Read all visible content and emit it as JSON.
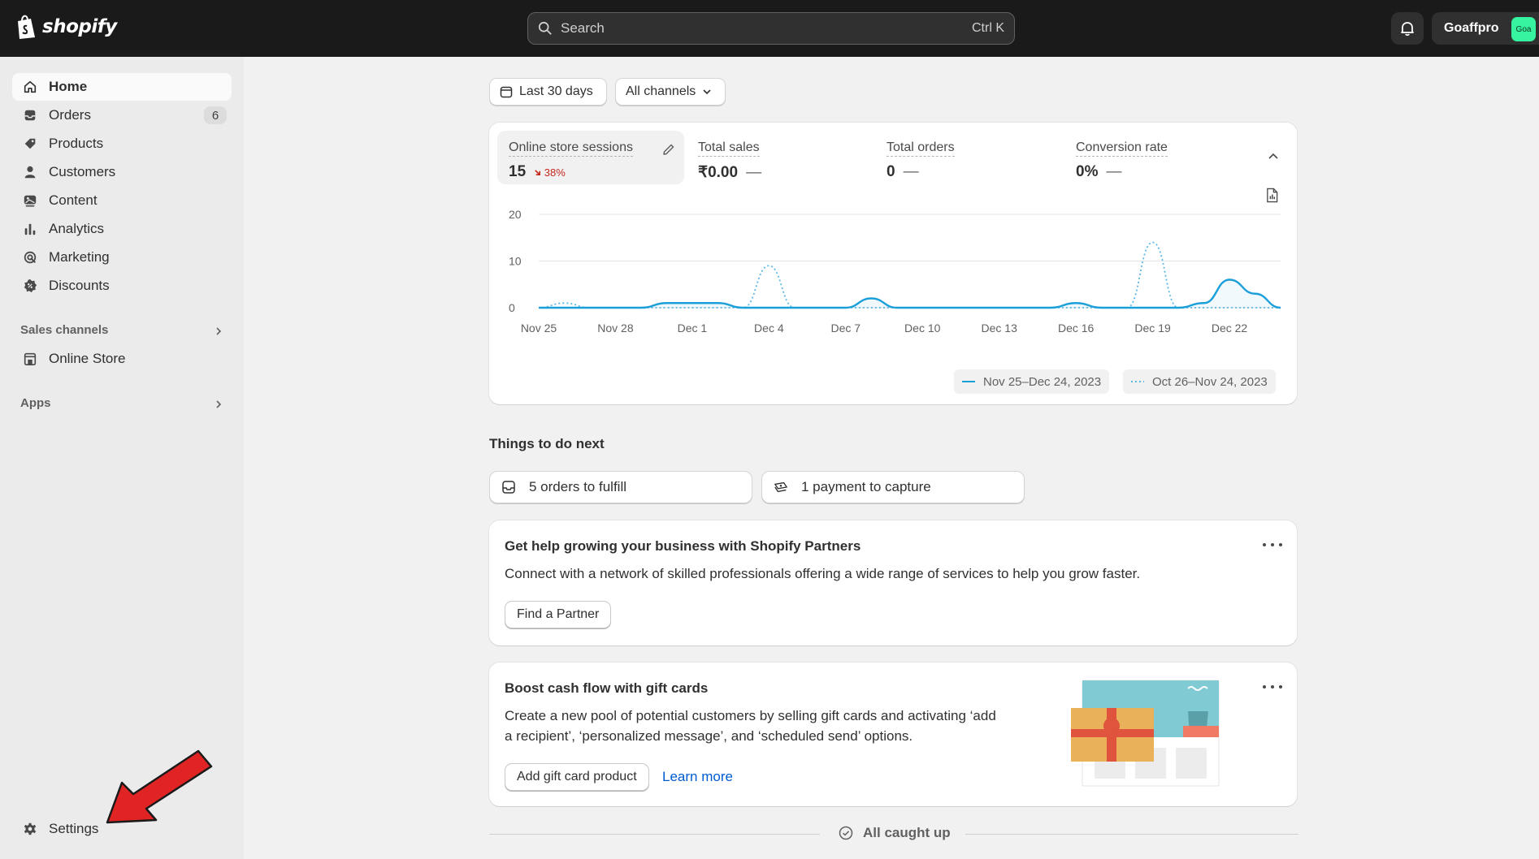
{
  "topbar": {
    "logo_text": "shopify",
    "search_placeholder": "Search",
    "search_shortcut": "Ctrl K",
    "store_name": "Goaffpro",
    "store_avatar": "Goa"
  },
  "sidebar": {
    "items": [
      {
        "label": "Home",
        "icon": "home-icon",
        "active": true
      },
      {
        "label": "Orders",
        "icon": "inbox-icon",
        "badge": "6"
      },
      {
        "label": "Products",
        "icon": "tag-icon"
      },
      {
        "label": "Customers",
        "icon": "person-icon"
      },
      {
        "label": "Content",
        "icon": "image-icon"
      },
      {
        "label": "Analytics",
        "icon": "bar-chart-icon"
      },
      {
        "label": "Marketing",
        "icon": "target-icon"
      },
      {
        "label": "Discounts",
        "icon": "discount-icon"
      }
    ],
    "sales_channels_title": "Sales channels",
    "online_store_label": "Online Store",
    "apps_title": "Apps",
    "settings_label": "Settings"
  },
  "filters": {
    "date_range": "Last 30 days",
    "channels": "All channels"
  },
  "metrics": [
    {
      "label": "Online store sessions",
      "value": "15",
      "change": "38%",
      "change_direction": "down"
    },
    {
      "label": "Total sales",
      "value": "₹0.00",
      "change": "—"
    },
    {
      "label": "Total orders",
      "value": "0",
      "change": "—"
    },
    {
      "label": "Conversion rate",
      "value": "0%",
      "change": "—"
    }
  ],
  "chart_data": {
    "type": "line",
    "ylim": [
      0,
      20
    ],
    "yticks": [
      "20",
      "10",
      "0"
    ],
    "xticks": [
      "Nov 25",
      "Nov 28",
      "Dec 1",
      "Dec 4",
      "Dec 7",
      "Dec 10",
      "Dec 13",
      "Dec 16",
      "Dec 19",
      "Dec 22"
    ],
    "series": [
      {
        "name": "Nov 25–Dec 24, 2023",
        "style": "solid",
        "color": "#1a9fd9",
        "values": [
          0,
          0,
          0,
          0,
          0,
          1,
          1,
          1,
          0,
          0,
          0,
          0,
          0,
          2,
          0,
          0,
          0,
          0,
          0,
          0,
          0,
          1,
          0,
          0,
          0,
          0,
          1,
          6,
          3,
          0
        ]
      },
      {
        "name": "Oct 26–Nov 24, 2023",
        "style": "dotted",
        "color": "#5ab8e6",
        "values": [
          0,
          1,
          0,
          0,
          0,
          0,
          0,
          0,
          0,
          9,
          0,
          0,
          0,
          0,
          0,
          0,
          0,
          0,
          0,
          0,
          0,
          0,
          0,
          0,
          14,
          0,
          0,
          0,
          0,
          0
        ]
      }
    ]
  },
  "things_to_do": {
    "title": "Things to do next",
    "tasks": [
      {
        "label": "5 orders to fulfill",
        "icon": "inbox-icon"
      },
      {
        "label": "1 payment to capture",
        "icon": "cash-icon"
      }
    ]
  },
  "partners_card": {
    "title": "Get help growing your business with Shopify Partners",
    "text": "Connect with a network of skilled professionals offering a wide range of services to help you grow faster.",
    "button": "Find a Partner"
  },
  "gift_card": {
    "title": "Boost cash flow with gift cards",
    "text_line1": "Create a new pool of potential customers by selling gift cards and activating ‘add",
    "text_line2": "a recipient’, ‘personalized message’, and ‘scheduled send’ options.",
    "button": "Add gift card product",
    "link": "Learn more"
  },
  "footer": {
    "caught_up": "All caught up"
  }
}
